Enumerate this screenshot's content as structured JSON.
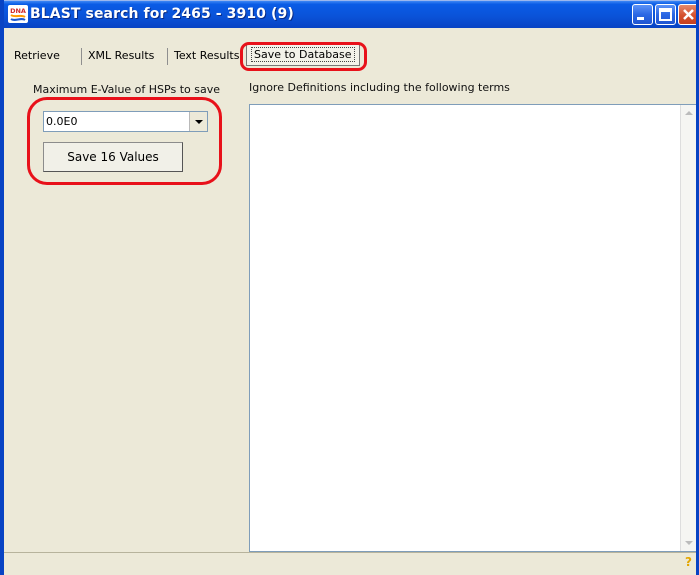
{
  "window": {
    "title": "BLAST search for 2465 - 3910 (9)"
  },
  "tabs": [
    {
      "label": "Retrieve"
    },
    {
      "label": "XML Results"
    },
    {
      "label": "Text Results"
    },
    {
      "label": "Save to Database"
    }
  ],
  "active_tab": "Save to Database",
  "left_panel": {
    "label": "Maximum E-Value of HSPs to save",
    "evalue_selected": "0.0E0",
    "save_button": "Save 16 Values"
  },
  "right_panel": {
    "label": "Ignore Definitions including the following terms",
    "textarea_value": ""
  },
  "status": {
    "help_symbol": "?"
  },
  "colors": {
    "titlebar": "#0a53d9",
    "highlight": "#e8111a",
    "background": "#ece9d8"
  },
  "icons": {
    "app_icon": "dna-icon",
    "minimize": "minimize-icon",
    "maximize": "maximize-icon",
    "close": "close-icon",
    "dropdown": "chevron-down-icon",
    "help": "help-icon"
  }
}
